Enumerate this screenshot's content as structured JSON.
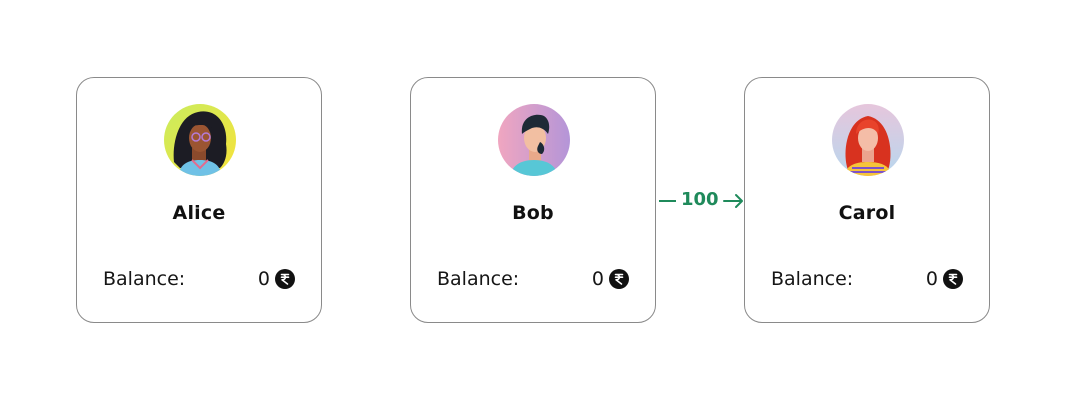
{
  "accounts": [
    {
      "name": "Alice",
      "balance_label": "Balance:",
      "balance": "0",
      "avatar": "woman-curly-hair-avatar-icon",
      "avatar_bg": "#e7f05a"
    },
    {
      "name": "Bob",
      "balance_label": "Balance:",
      "balance": "0",
      "avatar": "man-beard-avatar-icon",
      "avatar_bg": "#e7a9c9"
    },
    {
      "name": "Carol",
      "balance_label": "Balance:",
      "balance": "0",
      "avatar": "woman-red-hair-avatar-icon",
      "avatar_bg": "#d9c8e6"
    }
  ],
  "transfer": {
    "from": "Bob",
    "to": "Carol",
    "amount": "100",
    "color": "#1f8a5b"
  },
  "currency_icon": "rupee-coin-icon",
  "colors": {
    "card_border": "#8a8a8a",
    "text": "#111111"
  }
}
